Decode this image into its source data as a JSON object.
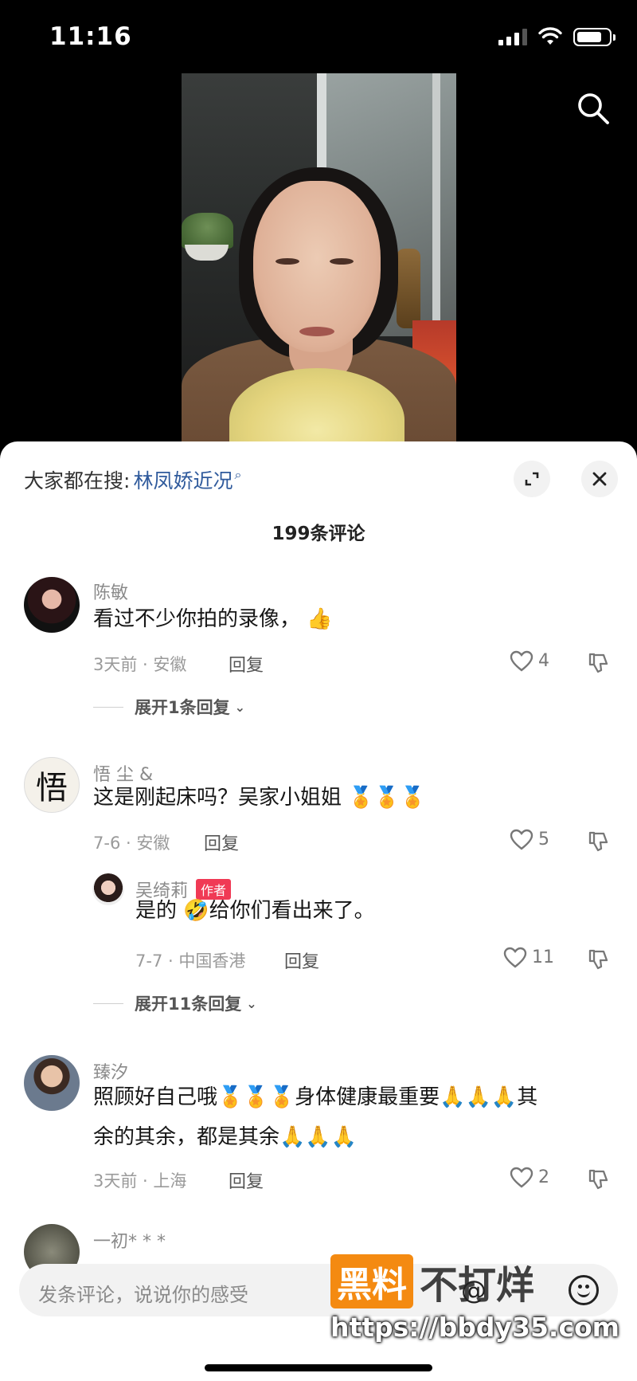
{
  "status_bar": {
    "time": "11:16"
  },
  "hot_search": {
    "label": "大家都在搜:",
    "query": "林凤娇近况"
  },
  "comments_header": {
    "count_label": "199条评论"
  },
  "comments": [
    {
      "user": "陈敏",
      "text": "看过不少你拍的录像，",
      "emoji": "👍",
      "meta": "3天前 · 安徽",
      "reply_label": "回复",
      "likes": "4",
      "expand_label": "展开1条回复"
    },
    {
      "user": "悟 尘 &",
      "text": "这是刚起床吗？吴家小姐姐",
      "emoji": "🏅🏅🏅",
      "meta": "7-6 · 安徽",
      "reply_label": "回复",
      "likes": "5",
      "reply": {
        "user": "吴绮莉",
        "badge": "作者",
        "text_before": "是的",
        "emoji": "🤣",
        "text_after": "给你们看出来了。",
        "meta": "7-7 · 中国香港",
        "reply_label": "回复",
        "likes": "11"
      },
      "expand_label": "展开11条回复"
    },
    {
      "user": "臻汐",
      "line1_a": "照顾好自己哦",
      "line1_emoji_a": "🏅🏅🏅",
      "line1_b": "身体健康最重要",
      "line1_emoji_b": "🙏🙏🙏",
      "line1_c": "其",
      "line2_a": "余的其余，都是其余",
      "line2_emoji": "🙏🙏🙏",
      "meta": "3天前 · 上海",
      "reply_label": "回复",
      "likes": "2"
    },
    {
      "user": "一初* * *"
    }
  ],
  "input": {
    "placeholder": "发条评论，说说你的感受"
  },
  "watermark": {
    "brand_box": "黑料",
    "brand_text": "不打烊",
    "url": "https://bbdy35.com"
  }
}
